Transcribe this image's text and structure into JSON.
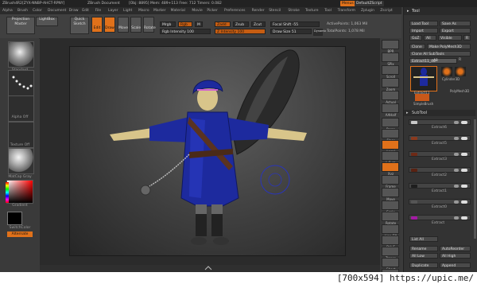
{
  "titlebar": {
    "app": "ZBrush4R2",
    "file": "[ZYX-NNBP-AHCT-RPNY]",
    "document": "ZBrush Document",
    "stats": "[Obj: 8895]  Mem: 489+113  Free: 712  Timers: 0.082",
    "menus_tag": "Menus",
    "script_tag": "DefaultZScript"
  },
  "menubar": [
    "Alpha",
    "Brush",
    "Color",
    "Document",
    "Draw",
    "Edit",
    "File",
    "Layer",
    "Light",
    "Macro",
    "Marker",
    "Material",
    "Movie",
    "Picker",
    "Preferences",
    "Render",
    "Stencil",
    "Stroke",
    "Texture",
    "Tool",
    "Transform",
    "Zplugin",
    "Zscript"
  ],
  "shelf": {
    "projection_master": "Projection Master",
    "lightbox": "LightBox",
    "quick_sketch": "Quick Sketch",
    "edit": "Edit",
    "draw": "Draw",
    "move": "Move",
    "scale": "Scale",
    "rotate": "Rotate",
    "mrgb": "Mrgb",
    "rgb": "Rgb",
    "m": "M",
    "zadd": "Zadd",
    "zsub": "Zsub",
    "zcut": "Zcut",
    "rgb_intensity": "Rgb Intensity 100",
    "z_intensity": "Z Intensity 100",
    "focal_shift": "Focal Shift -55",
    "draw_size": "Draw Size 51",
    "dynamic": "Dynamic",
    "active_points": "ActivePoints: 1,063 Mil",
    "total_points": "TotalPoints: 1,078 Mil"
  },
  "leftshelf": {
    "brush": "Standard",
    "stroke": "Dots",
    "alpha": "Alpha Off",
    "texture": "Texture Off",
    "material": "MatCap Gray",
    "gradient": "Gradient",
    "switch_color": "SwitchColor",
    "alternate": "Alternate"
  },
  "rightshelf": [
    "BPR",
    "SPix",
    "Scroll",
    "Zoom",
    "Actual",
    "AAHalf",
    "Persp",
    "Floor",
    "Local",
    "L.Sym",
    "Xyz",
    "Frame",
    "Move",
    "Scale",
    "Rotate",
    "Line Fill",
    "PolyF",
    "Transp",
    "Ghost",
    "Solo",
    "Xpose"
  ],
  "tool": {
    "title": "Tool",
    "load_tool": "Load Tool",
    "save_as": "Save As",
    "import": "Import",
    "export": "Export",
    "goz": "GoZ",
    "all": "All",
    "visible": "Visible",
    "r": "R",
    "clone": "Clone",
    "make_polymesh": "Make PolyMesh3D",
    "clone_all_subtools": "Clone All SubTools",
    "extract_field": "Extract11_40",
    "extract_count": "48",
    "thumb_main": "Extract11",
    "thumb_cylinder": "Cylinder3D",
    "thumb_polymesh": "PolyMesh3D",
    "thumb_simple": "SimpleBrush",
    "subtool_header": "SubTool",
    "subtools": [
      {
        "label": "Extract6",
        "color": "#c9c9c9"
      },
      {
        "label": "Extract5",
        "color": "#8b3a1e"
      },
      {
        "label": "Extract3",
        "color": "#6e2a16"
      },
      {
        "label": "Extract2",
        "color": "#5a2212"
      },
      {
        "label": "Extract1",
        "color": "#1e1e1e"
      },
      {
        "label": "Extract0",
        "color": "#555555"
      },
      {
        "label": "Extract",
        "color": "#a41aa4"
      }
    ],
    "list_all": "List All",
    "rename": "Rename",
    "autoreorder": "AutoReorder",
    "all_low": "All Low",
    "all_high": "All High",
    "duplicate": "Duplicate",
    "append": "Append"
  },
  "colors": {
    "accent_orange": "#e0711a",
    "tool_highlight": "#e0711a",
    "character_robe": "#1d2a9e",
    "character_skin": "#d8c58a"
  },
  "watermark": "[700x594] https://upic.me/"
}
